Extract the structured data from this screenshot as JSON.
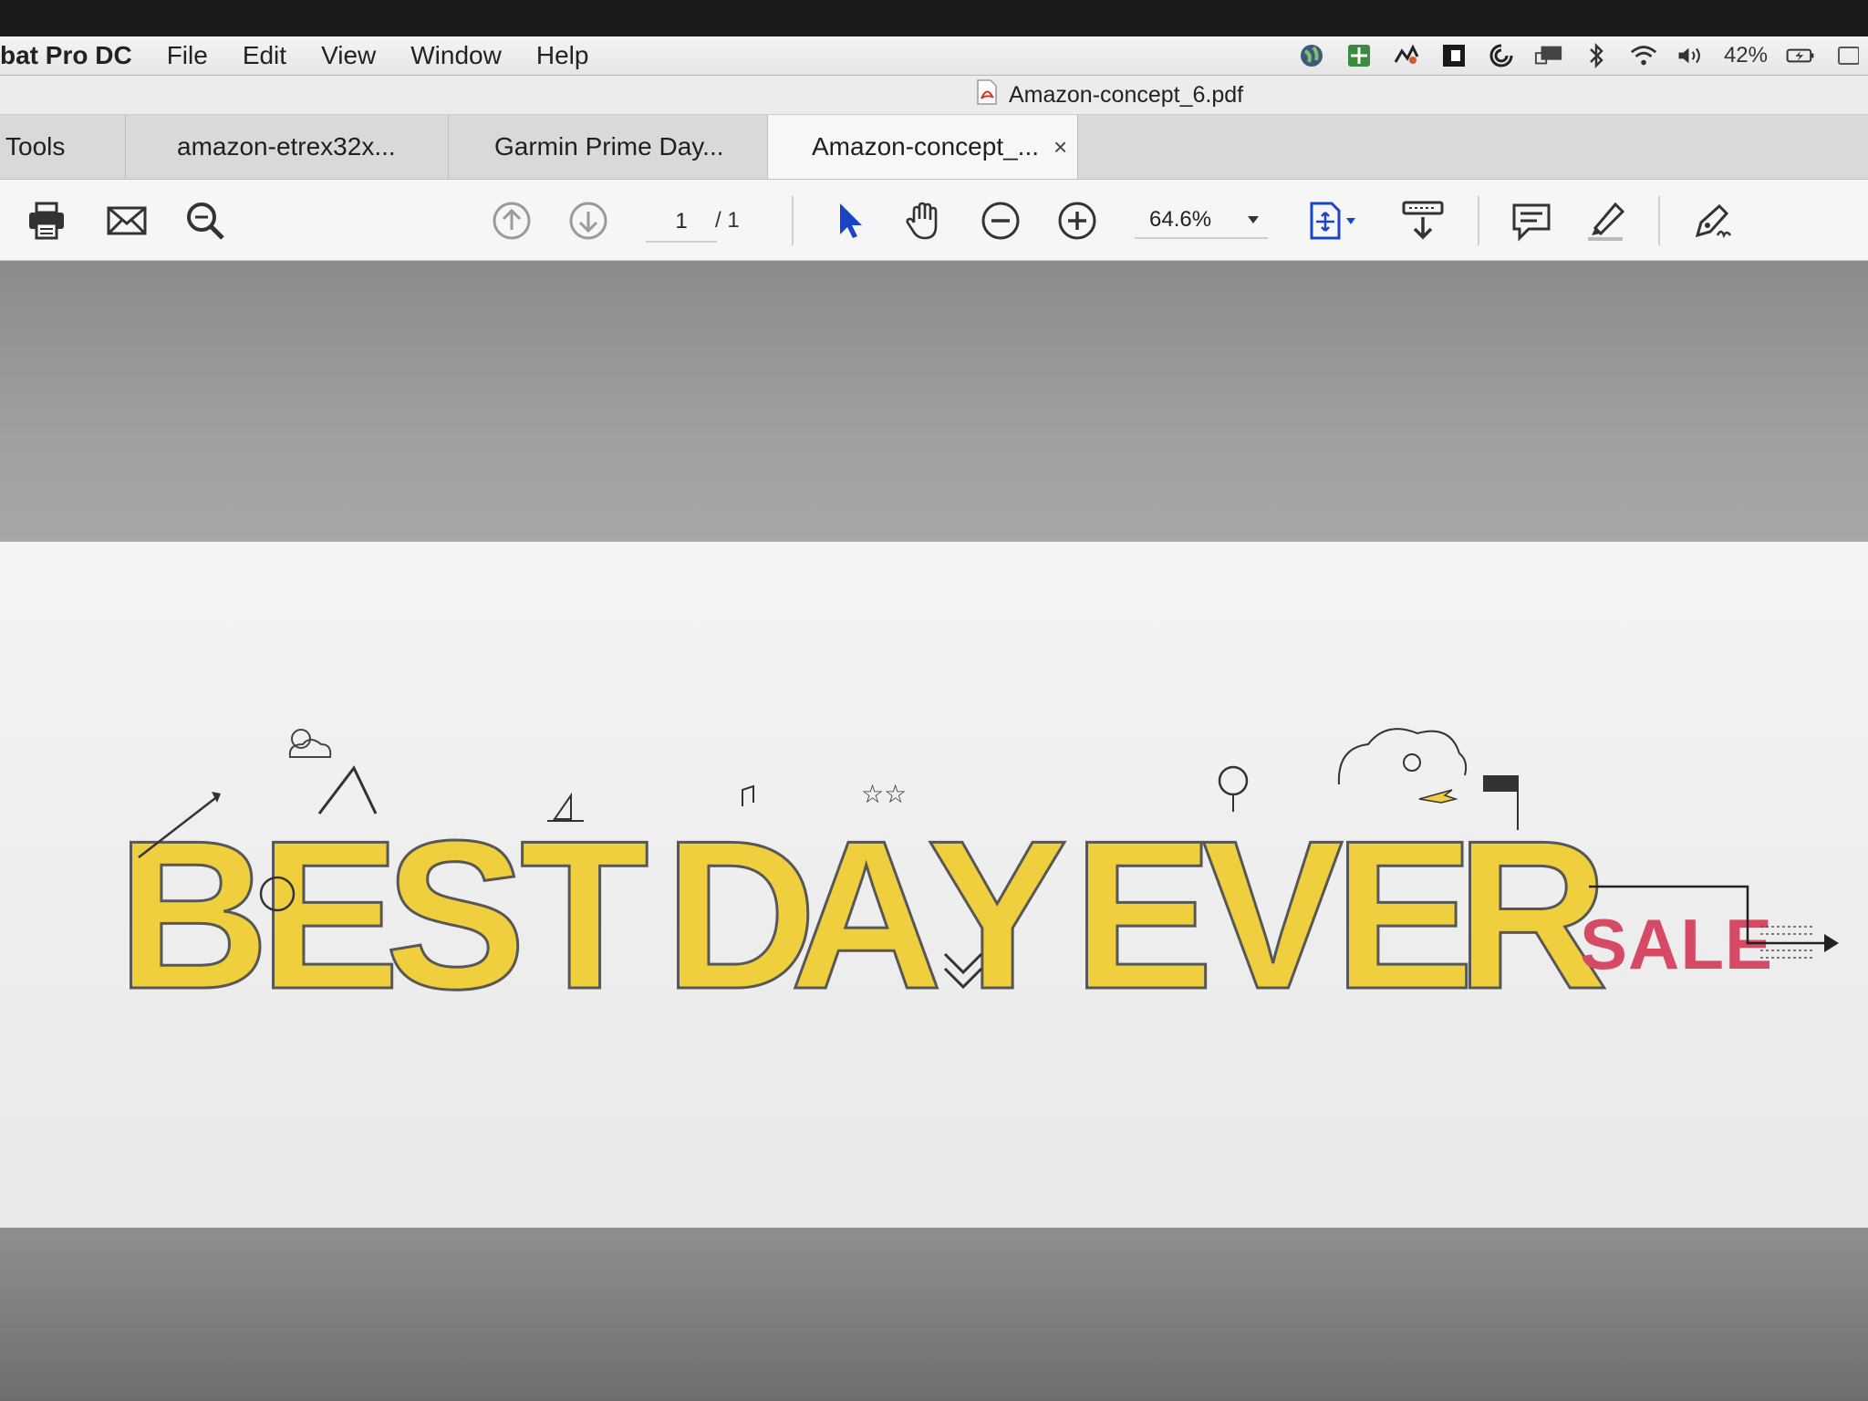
{
  "menubar": {
    "app_name": "bat Pro DC",
    "items": [
      "File",
      "Edit",
      "View",
      "Window",
      "Help"
    ],
    "battery": "42%"
  },
  "window": {
    "document_title": "Amazon-concept_6.pdf"
  },
  "tabs": [
    {
      "label": "Tools",
      "active": false
    },
    {
      "label": "amazon-etrex32x...",
      "active": false
    },
    {
      "label": "Garmin Prime Day...",
      "active": false
    },
    {
      "label": "Amazon-concept_...",
      "active": true,
      "close": "×"
    }
  ],
  "toolbar": {
    "page_current": "1",
    "page_total": "/ 1",
    "zoom": "64.6%"
  },
  "artwork": {
    "letters": [
      "B",
      "E",
      "S",
      "T",
      "D",
      "A",
      "Y",
      "E",
      "V",
      "E",
      "R"
    ],
    "sale": "SALE"
  },
  "colors": {
    "accent_yellow": "#f0cf3e",
    "sale_pink": "#d64a65",
    "select_tool_blue": "#1a44c8"
  }
}
